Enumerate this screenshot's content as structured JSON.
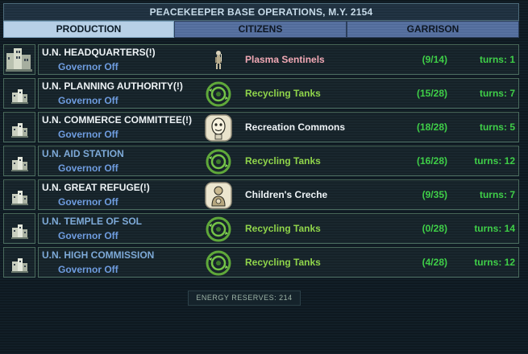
{
  "header": {
    "title": "PEACEKEEPER BASE OPERATIONS,  M.Y. 2154"
  },
  "tabs": [
    {
      "label": "PRODUCTION"
    },
    {
      "label": "CITIZENS"
    },
    {
      "label": "GARRISON"
    }
  ],
  "bases": [
    {
      "name": "U.N. HEADQUARTERS(!)",
      "governor": "Governor Off",
      "item": "Plasma Sentinels",
      "progress": "(9/14)",
      "turns": "turns:  1",
      "icon": "plasma-sentinel-icon",
      "name_color": "#eef3f6",
      "item_color": "#f0a8b4"
    },
    {
      "name": "U.N. PLANNING AUTHORITY(!)",
      "governor": "Governor Off",
      "item": "Recycling Tanks",
      "progress": "(15/28)",
      "turns": "turns:  7",
      "icon": "recycling-tanks-icon",
      "name_color": "#eef3f6",
      "item_color": "#8fd44a"
    },
    {
      "name": "U.N. COMMERCE COMMITTEE(!)",
      "governor": "Governor Off",
      "item": "Recreation Commons",
      "progress": "(18/28)",
      "turns": "turns:  5",
      "icon": "recreation-commons-icon",
      "name_color": "#eef3f6",
      "item_color": "#eef3f6"
    },
    {
      "name": "U.N. AID STATION",
      "governor": "Governor Off",
      "item": "Recycling Tanks",
      "progress": "(16/28)",
      "turns": "turns:  12",
      "icon": "recycling-tanks-icon",
      "name_color": "#7eaad8",
      "item_color": "#8fd44a"
    },
    {
      "name": "U.N. GREAT REFUGE(!)",
      "governor": "Governor Off",
      "item": "Children's Creche",
      "progress": "(9/35)",
      "turns": "turns:  7",
      "icon": "childrens-creche-icon",
      "name_color": "#eef3f6",
      "item_color": "#eef3f6"
    },
    {
      "name": "U.N. TEMPLE OF SOL",
      "governor": "Governor Off",
      "item": "Recycling Tanks",
      "progress": "(0/28)",
      "turns": "turns:  14",
      "icon": "recycling-tanks-icon",
      "name_color": "#7eaad8",
      "item_color": "#8fd44a"
    },
    {
      "name": "U.N. HIGH COMMISSION",
      "governor": "Governor Off",
      "item": "Recycling Tanks",
      "progress": "(4/28)",
      "turns": "turns:  12",
      "icon": "recycling-tanks-icon",
      "name_color": "#7eaad8",
      "item_color": "#8fd44a"
    }
  ],
  "footer": {
    "energy_reserves": "ENERGY RESERVES: 214"
  }
}
